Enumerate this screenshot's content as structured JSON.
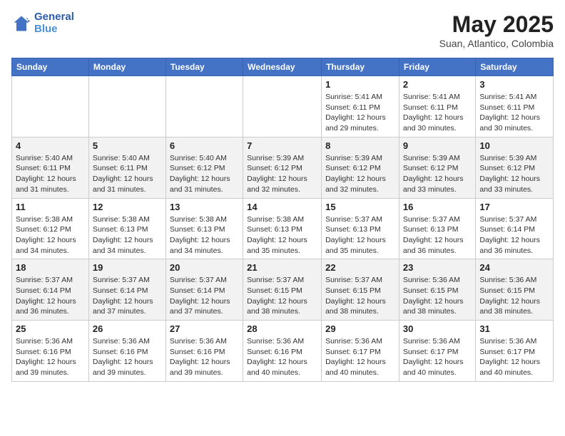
{
  "header": {
    "logo_line1": "General",
    "logo_line2": "Blue",
    "month_year": "May 2025",
    "location": "Suan, Atlantico, Colombia"
  },
  "days_of_week": [
    "Sunday",
    "Monday",
    "Tuesday",
    "Wednesday",
    "Thursday",
    "Friday",
    "Saturday"
  ],
  "weeks": [
    [
      {
        "day": "",
        "info": ""
      },
      {
        "day": "",
        "info": ""
      },
      {
        "day": "",
        "info": ""
      },
      {
        "day": "",
        "info": ""
      },
      {
        "day": "1",
        "info": "Sunrise: 5:41 AM\nSunset: 6:11 PM\nDaylight: 12 hours and 29 minutes."
      },
      {
        "day": "2",
        "info": "Sunrise: 5:41 AM\nSunset: 6:11 PM\nDaylight: 12 hours and 30 minutes."
      },
      {
        "day": "3",
        "info": "Sunrise: 5:41 AM\nSunset: 6:11 PM\nDaylight: 12 hours and 30 minutes."
      }
    ],
    [
      {
        "day": "4",
        "info": "Sunrise: 5:40 AM\nSunset: 6:11 PM\nDaylight: 12 hours and 31 minutes."
      },
      {
        "day": "5",
        "info": "Sunrise: 5:40 AM\nSunset: 6:11 PM\nDaylight: 12 hours and 31 minutes."
      },
      {
        "day": "6",
        "info": "Sunrise: 5:40 AM\nSunset: 6:12 PM\nDaylight: 12 hours and 31 minutes."
      },
      {
        "day": "7",
        "info": "Sunrise: 5:39 AM\nSunset: 6:12 PM\nDaylight: 12 hours and 32 minutes."
      },
      {
        "day": "8",
        "info": "Sunrise: 5:39 AM\nSunset: 6:12 PM\nDaylight: 12 hours and 32 minutes."
      },
      {
        "day": "9",
        "info": "Sunrise: 5:39 AM\nSunset: 6:12 PM\nDaylight: 12 hours and 33 minutes."
      },
      {
        "day": "10",
        "info": "Sunrise: 5:39 AM\nSunset: 6:12 PM\nDaylight: 12 hours and 33 minutes."
      }
    ],
    [
      {
        "day": "11",
        "info": "Sunrise: 5:38 AM\nSunset: 6:12 PM\nDaylight: 12 hours and 34 minutes."
      },
      {
        "day": "12",
        "info": "Sunrise: 5:38 AM\nSunset: 6:13 PM\nDaylight: 12 hours and 34 minutes."
      },
      {
        "day": "13",
        "info": "Sunrise: 5:38 AM\nSunset: 6:13 PM\nDaylight: 12 hours and 34 minutes."
      },
      {
        "day": "14",
        "info": "Sunrise: 5:38 AM\nSunset: 6:13 PM\nDaylight: 12 hours and 35 minutes."
      },
      {
        "day": "15",
        "info": "Sunrise: 5:37 AM\nSunset: 6:13 PM\nDaylight: 12 hours and 35 minutes."
      },
      {
        "day": "16",
        "info": "Sunrise: 5:37 AM\nSunset: 6:13 PM\nDaylight: 12 hours and 36 minutes."
      },
      {
        "day": "17",
        "info": "Sunrise: 5:37 AM\nSunset: 6:14 PM\nDaylight: 12 hours and 36 minutes."
      }
    ],
    [
      {
        "day": "18",
        "info": "Sunrise: 5:37 AM\nSunset: 6:14 PM\nDaylight: 12 hours and 36 minutes."
      },
      {
        "day": "19",
        "info": "Sunrise: 5:37 AM\nSunset: 6:14 PM\nDaylight: 12 hours and 37 minutes."
      },
      {
        "day": "20",
        "info": "Sunrise: 5:37 AM\nSunset: 6:14 PM\nDaylight: 12 hours and 37 minutes."
      },
      {
        "day": "21",
        "info": "Sunrise: 5:37 AM\nSunset: 6:15 PM\nDaylight: 12 hours and 38 minutes."
      },
      {
        "day": "22",
        "info": "Sunrise: 5:37 AM\nSunset: 6:15 PM\nDaylight: 12 hours and 38 minutes."
      },
      {
        "day": "23",
        "info": "Sunrise: 5:36 AM\nSunset: 6:15 PM\nDaylight: 12 hours and 38 minutes."
      },
      {
        "day": "24",
        "info": "Sunrise: 5:36 AM\nSunset: 6:15 PM\nDaylight: 12 hours and 38 minutes."
      }
    ],
    [
      {
        "day": "25",
        "info": "Sunrise: 5:36 AM\nSunset: 6:16 PM\nDaylight: 12 hours and 39 minutes."
      },
      {
        "day": "26",
        "info": "Sunrise: 5:36 AM\nSunset: 6:16 PM\nDaylight: 12 hours and 39 minutes."
      },
      {
        "day": "27",
        "info": "Sunrise: 5:36 AM\nSunset: 6:16 PM\nDaylight: 12 hours and 39 minutes."
      },
      {
        "day": "28",
        "info": "Sunrise: 5:36 AM\nSunset: 6:16 PM\nDaylight: 12 hours and 40 minutes."
      },
      {
        "day": "29",
        "info": "Sunrise: 5:36 AM\nSunset: 6:17 PM\nDaylight: 12 hours and 40 minutes."
      },
      {
        "day": "30",
        "info": "Sunrise: 5:36 AM\nSunset: 6:17 PM\nDaylight: 12 hours and 40 minutes."
      },
      {
        "day": "31",
        "info": "Sunrise: 5:36 AM\nSunset: 6:17 PM\nDaylight: 12 hours and 40 minutes."
      }
    ]
  ]
}
